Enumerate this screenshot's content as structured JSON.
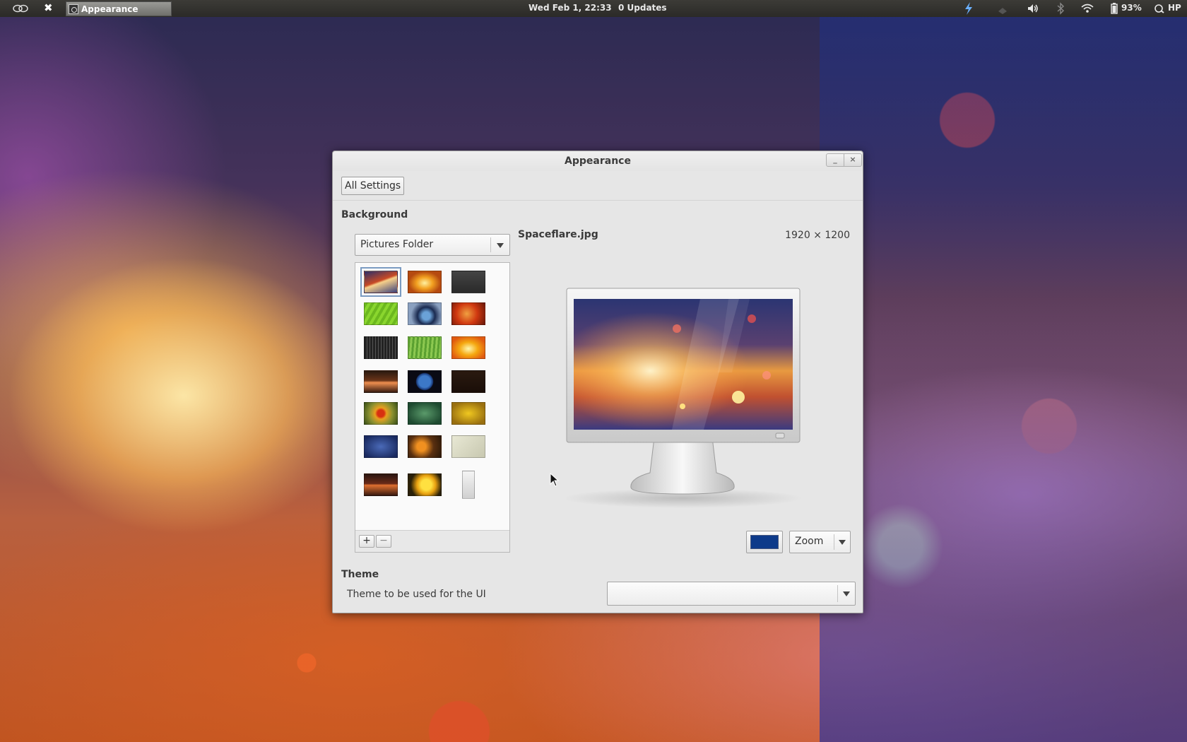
{
  "panel": {
    "clock": "Wed Feb  1, 22:33",
    "updates": "0 Updates",
    "battery": "93%",
    "user": "HP",
    "task_title": "Appearance"
  },
  "window": {
    "title": "Appearance",
    "all_settings_label": "All Settings",
    "background_heading": "Background",
    "source_combo_value": "Pictures Folder",
    "file_name": "Spaceflare.jpg",
    "file_size": "1920 × 1200",
    "zoom_combo_value": "Zoom",
    "theme_heading": "Theme",
    "theme_label": "Theme to be used for the UI",
    "theme_combo_value": "",
    "color_swatch": "#0d3a8a",
    "add_label": "+",
    "remove_label": "−"
  },
  "thumbnails": [
    {
      "bg": "linear-gradient(160deg,#2a2f6a,#c84a25 45%,#f7d08a 52%,#3a3f7a)",
      "selected": true
    },
    {
      "bg": "radial-gradient(ellipse at 50% 55%,#fff0a0,#f2a020 35%,#b54a10 70%)",
      "selected": false
    },
    {
      "bg": "linear-gradient(180deg,#444,#2a2a2a)",
      "selected": false
    },
    {
      "bg": "repeating-linear-gradient(120deg,#6cb81e 0 4px,#8ad62e 4px 8px)",
      "selected": false
    },
    {
      "bg": "radial-gradient(circle at 55% 60%,#6aa2d8 0 18%,#1a2a50 40%,#8aa0c0 70%)",
      "selected": false
    },
    {
      "bg": "radial-gradient(circle at 45% 50%,#f0a040,#d03810 50%,#6a1808)",
      "selected": false
    },
    {
      "bg": "repeating-linear-gradient(90deg,#222 0 3px,#555 3px 4px),#222",
      "selected": false
    },
    {
      "bg": "repeating-linear-gradient(95deg,#5aa030 0 3px,#8cc850 3px 6px)",
      "selected": false
    },
    {
      "bg": "radial-gradient(ellipse at 50% 55%,#fff8b0,#f5a810 40%,#e05a10 80%)",
      "selected": false
    },
    {
      "bg": "linear-gradient(180deg,#2a1a10,#6a3418 45%,#f09050 55%,#3a1c10)",
      "selected": false
    },
    {
      "bg": "radial-gradient(circle at 50% 50%,#3c78c8 0 30%,#1a3a7a 42%,#0a0a14 46%)",
      "selected": false
    },
    {
      "bg": "linear-gradient(180deg,#2a1a10,#1a0e08)",
      "selected": false
    },
    {
      "bg": "radial-gradient(circle at 50% 50%,#d83010 0 18%,#e8a020 30%,#8a9030 60%,#3a5018)",
      "selected": false
    },
    {
      "bg": "radial-gradient(ellipse at 50% 50%,#5a9a6a,#1e4a30 80%)",
      "selected": false
    },
    {
      "bg": "radial-gradient(ellipse at 50% 50%,#f0c820,#9a7010 80%)",
      "selected": false
    },
    {
      "bg": "radial-gradient(ellipse at 50% 50%,#4a6ab8,#1a2a60 85%)",
      "selected": false
    },
    {
      "bg": "radial-gradient(circle at 40% 50%,#f09020 0 20%,#5a3010 55%,#2a1808)",
      "selected": false
    },
    {
      "bg": "linear-gradient(135deg,#e8e8d4,#c8c8b0)",
      "selected": false
    },
    {
      "bg": "linear-gradient(180deg,#2a1510,#6a2a18 45%,#e07030 52%,#3a1a10)",
      "selected": false
    },
    {
      "bg": "radial-gradient(circle at 55% 50%,#ffe040 0 25%,#e8a010 45%,#2a2008 75%)",
      "selected": false
    },
    {
      "bg": "linear-gradient(180deg,#f4f4f4,#d0d0d0)",
      "selected": false
    }
  ]
}
